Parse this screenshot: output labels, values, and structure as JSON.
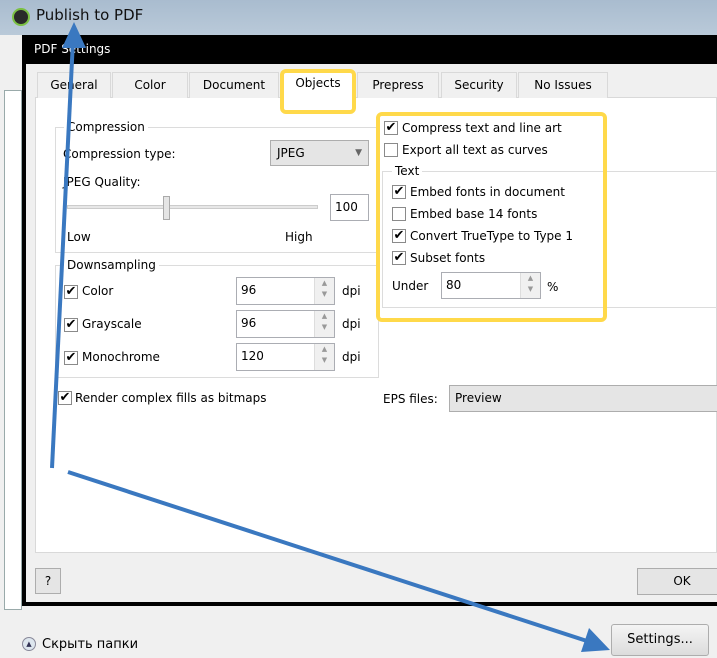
{
  "window": {
    "title": "Publish to PDF",
    "hide_folders": "Скрыть папки",
    "settings_button": "Settings..."
  },
  "dialog": {
    "title": "PDF Settings",
    "help_button": "?",
    "ok_button": "OK",
    "tabs": [
      {
        "label": "General"
      },
      {
        "label": "Color"
      },
      {
        "label": "Document"
      },
      {
        "label": "Objects",
        "selected": true
      },
      {
        "label": "Prepress"
      },
      {
        "label": "Security"
      },
      {
        "label": "No Issues"
      }
    ]
  },
  "compression": {
    "group_label": "Compression",
    "type_label": "Compression type:",
    "type_value": "JPEG",
    "quality_label": "JPEG Quality:",
    "quality_value": "100",
    "slider_percent": 40,
    "low": "Low",
    "high": "High"
  },
  "downsampling": {
    "group_label": "Downsampling",
    "rows": [
      {
        "label": "Color",
        "checked": true,
        "value": "96",
        "unit": "dpi"
      },
      {
        "label": "Grayscale",
        "checked": true,
        "value": "96",
        "unit": "dpi"
      },
      {
        "label": "Monochrome",
        "checked": true,
        "value": "120",
        "unit": "dpi"
      }
    ]
  },
  "render_complex": {
    "label": "Render complex fills as bitmaps",
    "checked": true
  },
  "eps": {
    "label": "EPS files:",
    "value": "Preview"
  },
  "objects": {
    "compress_text": {
      "label": "Compress text and line art",
      "checked": true
    },
    "export_curves": {
      "label": "Export all text as curves",
      "checked": false
    }
  },
  "text": {
    "group_label": "Text",
    "items": [
      {
        "label": "Embed fonts in document",
        "checked": true
      },
      {
        "label": "Embed base 14 fonts",
        "checked": false
      },
      {
        "label": "Convert TrueType to Type 1",
        "checked": true
      },
      {
        "label": "Subset fonts",
        "checked": true
      }
    ],
    "under_label": "Under",
    "under_value": "80",
    "under_unit": "%"
  },
  "colors": {
    "highlight": "#ffd94a",
    "arrow": "#3a78c0"
  }
}
